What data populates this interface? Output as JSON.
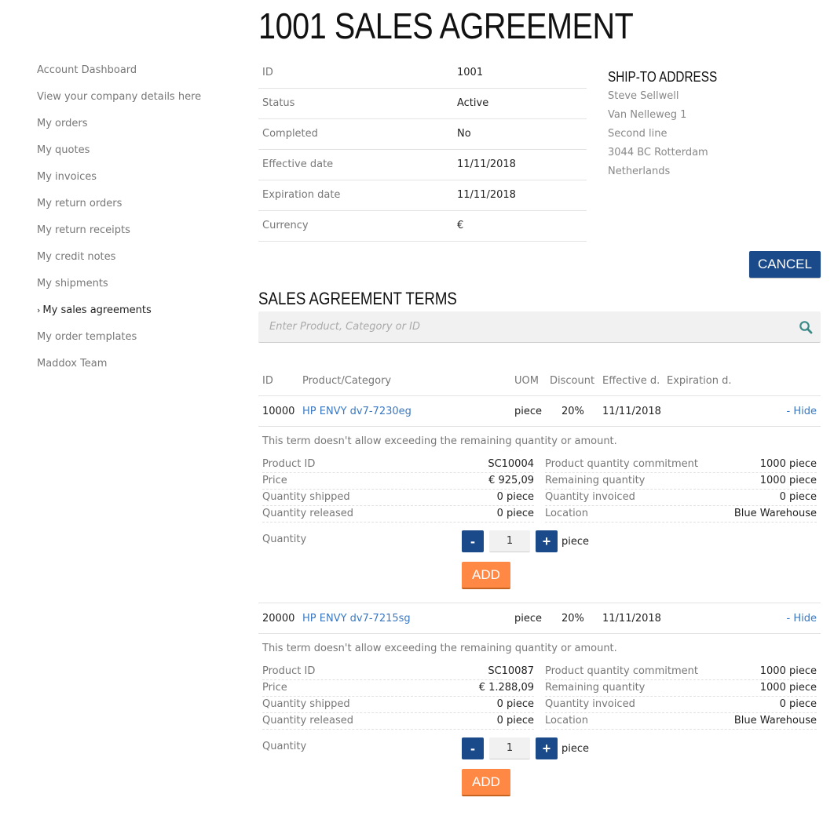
{
  "page": {
    "title": "1001 SALES AGREEMENT"
  },
  "sidebar": {
    "items": [
      {
        "label": "Account Dashboard",
        "active": false
      },
      {
        "label": "View your company details here",
        "active": false
      },
      {
        "label": "My orders",
        "active": false
      },
      {
        "label": "My quotes",
        "active": false
      },
      {
        "label": "My invoices",
        "active": false
      },
      {
        "label": "My return orders",
        "active": false
      },
      {
        "label": "My return receipts",
        "active": false
      },
      {
        "label": "My credit notes",
        "active": false
      },
      {
        "label": "My shipments",
        "active": false
      },
      {
        "label": "My sales agreements",
        "active": true
      },
      {
        "label": "My order templates",
        "active": false
      },
      {
        "label": "Maddox Team",
        "active": false
      }
    ],
    "active_marker": "›"
  },
  "info": {
    "rows": [
      {
        "label": "ID",
        "value": "1001"
      },
      {
        "label": "Status",
        "value": "Active"
      },
      {
        "label": "Completed",
        "value": "No"
      },
      {
        "label": "Effective date",
        "value": "11/11/2018"
      },
      {
        "label": "Expiration date",
        "value": "11/11/2018"
      },
      {
        "label": "Currency",
        "value": "€"
      }
    ]
  },
  "ship_to": {
    "heading": "SHIP-TO ADDRESS",
    "lines": [
      "Steve Sellwell",
      "Van Nelleweg 1",
      "Second line",
      "3044 BC Rotterdam",
      "Netherlands"
    ]
  },
  "actions": {
    "cancel_label": "CANCEL"
  },
  "terms": {
    "heading": "SALES AGREEMENT TERMS",
    "search_placeholder": "Enter Product, Category or ID",
    "search_value": "",
    "search_icon": "search-icon",
    "columns": {
      "id": "ID",
      "product": "Product/Category",
      "uom": "UOM",
      "discount": "Discount",
      "effective": "Effective d.",
      "expiration": "Expiration d."
    },
    "items": [
      {
        "id": "10000",
        "product": "HP ENVY dv7-7230eg",
        "uom": "piece",
        "discount": "20%",
        "effective": "11/11/2018",
        "expiration": "",
        "toggle_label": "- Hide",
        "note": "This term doesn't allow exceeding the remaining quantity or amount.",
        "left": [
          {
            "label": "Product ID",
            "value": "SC10004"
          },
          {
            "label": "Price",
            "value": "€ 925,09"
          },
          {
            "label": "Quantity shipped",
            "value": "0 piece"
          },
          {
            "label": "Quantity released",
            "value": "0 piece"
          }
        ],
        "right": [
          {
            "label": "Product quantity commitment",
            "value": "1000 piece"
          },
          {
            "label": "Remaining quantity",
            "value": "1000 piece"
          },
          {
            "label": "Quantity invoiced",
            "value": "0 piece"
          },
          {
            "label": "Location",
            "value": "Blue Warehouse"
          }
        ],
        "quantity_label": "Quantity",
        "quantity_value": "1",
        "minus_label": "-",
        "plus_label": "+",
        "unit": "piece",
        "add_label": "ADD"
      },
      {
        "id": "20000",
        "product": "HP ENVY dv7-7215sg",
        "uom": "piece",
        "discount": "20%",
        "effective": "11/11/2018",
        "expiration": "",
        "toggle_label": "- Hide",
        "note": "This term doesn't allow exceeding the remaining quantity or amount.",
        "left": [
          {
            "label": "Product ID",
            "value": "SC10087"
          },
          {
            "label": "Price",
            "value": "€ 1.288,09"
          },
          {
            "label": "Quantity shipped",
            "value": "0 piece"
          },
          {
            "label": "Quantity released",
            "value": "0 piece"
          }
        ],
        "right": [
          {
            "label": "Product quantity commitment",
            "value": "1000 piece"
          },
          {
            "label": "Remaining quantity",
            "value": "1000 piece"
          },
          {
            "label": "Quantity invoiced",
            "value": "0 piece"
          },
          {
            "label": "Location",
            "value": "Blue Warehouse"
          }
        ],
        "quantity_label": "Quantity",
        "quantity_value": "1",
        "minus_label": "-",
        "plus_label": "+",
        "unit": "piece",
        "add_label": "ADD"
      }
    ]
  },
  "colors": {
    "primary_button": "#1a4a8a",
    "add_button": "#ff8844",
    "link": "#3a78c2",
    "search_icon": "#3a8a88"
  }
}
